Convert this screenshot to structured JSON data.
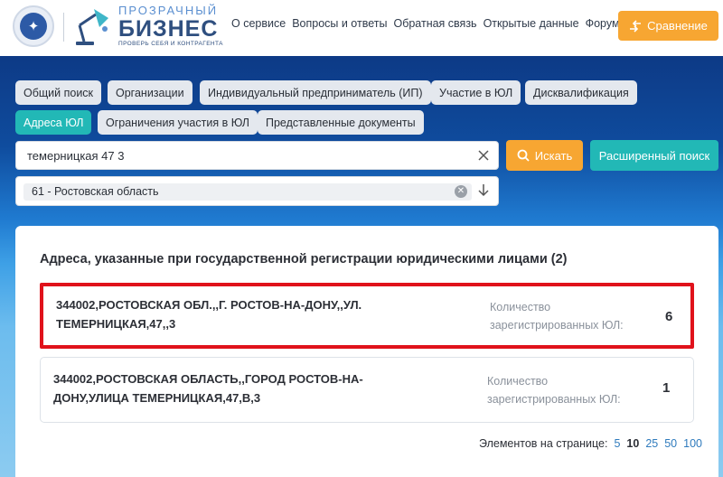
{
  "header": {
    "logo_small": "ПРОЗРАЧНЫЙ",
    "logo_big": "БИЗНЕС",
    "logo_tagline": "ПРОВЕРЬ СЕБЯ И КОНТРАГЕНТА",
    "nav": [
      "О сервисе",
      "Вопросы и ответы",
      "Обратная связь",
      "Открытые данные",
      "Форум"
    ],
    "compare_label": "Сравнение"
  },
  "filters": {
    "chips": [
      {
        "label": "Общий поиск",
        "active": false
      },
      {
        "label": "Организации",
        "active": false
      },
      {
        "label": "Индивидуальный предприниматель (ИП)",
        "active": false
      },
      {
        "label": "Участие в ЮЛ",
        "active": false
      },
      {
        "label": "Дисквалификация",
        "active": false
      },
      {
        "label": "Адреса ЮЛ",
        "active": true
      },
      {
        "label": "Ограничения участия в ЮЛ",
        "active": false
      },
      {
        "label": "Представленные документы",
        "active": false
      }
    ]
  },
  "search": {
    "value": "темерницкая 47 3",
    "button_label": "Искать",
    "advanced_label": "Расширенный поиск",
    "region_value": "61 - Ростовская область"
  },
  "results": {
    "title": "Адреса, указанные при государственной регистрации юридическими лицами (2)",
    "items": [
      {
        "address": "344002,РОСТОВСКАЯ ОБЛ.,,Г. РОСТОВ-НА-ДОНУ,,УЛ. ТЕМЕРНИЦКАЯ,47,,3",
        "count_label": "Количество зарегистрированных ЮЛ:",
        "count": "6"
      },
      {
        "address": "344002,РОСТОВСКАЯ ОБЛАСТЬ,,ГОРОД РОСТОВ-НА-ДОНУ,УЛИЦА ТЕМЕРНИЦКАЯ,47,В,3",
        "count_label": "Количество зарегистрированных ЮЛ:",
        "count": "1"
      }
    ]
  },
  "pager": {
    "label": "Элементов на странице:",
    "options": [
      "5",
      "10",
      "25",
      "50",
      "100"
    ],
    "current": "10"
  },
  "colors": {
    "accent_orange": "#f7a632",
    "accent_teal": "#22b8b6",
    "highlight_red": "#e0121b"
  }
}
